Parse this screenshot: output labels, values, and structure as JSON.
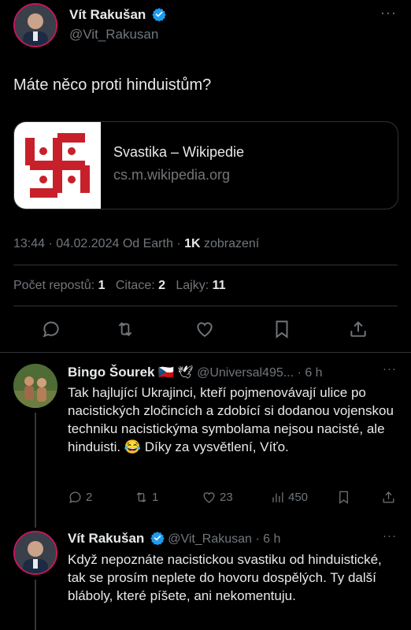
{
  "main_tweet": {
    "author_name": "Vít Rakušan",
    "handle": "@Vit_Rakusan",
    "text": "Máte něco proti hinduistům?",
    "link_card": {
      "title": "Svastika – Wikipedie",
      "domain": "cs.m.wikipedia.org"
    },
    "meta": {
      "time": "13:44",
      "date": "04.02.2024",
      "source": "Od Earth",
      "views_count": "1K",
      "views_label": "zobrazení"
    },
    "stats": {
      "reposts_label": "Počet repostů:",
      "reposts": "1",
      "quotes_label": "Citace:",
      "quotes": "2",
      "likes_label": "Lajky:",
      "likes": "11"
    }
  },
  "replies": [
    {
      "author_name": "Bingo Šourek",
      "emoji": "🇨🇿 🕊",
      "handle": "@Universal495...",
      "time": "6 h",
      "text": "Tak hajlující Ukrajinci, kteří pojmenovávají ulice po nacistických zločincích a zdobící si dodanou vojenskou techniku nacistickýma symbolama nejsou nacisté, ale hinduisti. 😂 Díky za vysvětlení, Víťo.",
      "replies": "2",
      "reposts": "1",
      "likes": "23",
      "views": "450"
    },
    {
      "author_name": "Vít Rakušan",
      "handle": "@Vit_Rakusan",
      "time": "6 h",
      "text": "Když nepoznáte nacistickou svastiku od hinduistické, tak se prosím neplete do hovoru dospělých. Ty další bláboly, které píšete, ani nekomentuju."
    }
  ],
  "icons": {
    "verified_color": "#1d9bf0",
    "swastika_color": "#c8202a"
  }
}
